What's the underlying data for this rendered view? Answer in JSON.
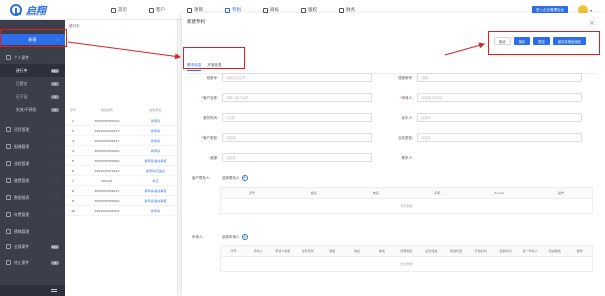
{
  "app": {
    "logo_name": "启翔",
    "logo_sub": "qixiang"
  },
  "topnav": [
    {
      "label": "首页",
      "icon": "home-icon",
      "active": false
    },
    {
      "label": "客户",
      "icon": "user-icon",
      "active": false
    },
    {
      "label": "项目",
      "icon": "project-icon",
      "active": false
    },
    {
      "label": "专利",
      "icon": "patent-icon",
      "active": true
    },
    {
      "label": "商标",
      "icon": "trademark-icon",
      "active": false
    },
    {
      "label": "版权",
      "icon": "copyright-icon",
      "active": false
    },
    {
      "label": "财务",
      "icon": "finance-icon",
      "active": false
    }
  ],
  "topbar": {
    "enter_button": "进入企业管理后台"
  },
  "sidebar": {
    "new_button": "新建",
    "items": [
      {
        "label": "个人案件",
        "count": "",
        "sub": false,
        "active": false
      },
      {
        "label": "进行中",
        "count": "99+",
        "sub": true,
        "active": true
      },
      {
        "label": "已提交",
        "count": "0",
        "sub": true,
        "active": false
      },
      {
        "label": "已下证",
        "count": "0",
        "sub": true,
        "active": false
      },
      {
        "label": "失效/不授权",
        "count": "0",
        "sub": true,
        "active": false
      },
      {
        "label": "项目管理",
        "count": "",
        "sub": false,
        "active": false
      },
      {
        "label": "配偶管理",
        "count": "",
        "sub": false,
        "active": false
      },
      {
        "label": "流程管理",
        "count": "",
        "sub": false,
        "active": false
      },
      {
        "label": "缴费管理",
        "count": "",
        "sub": false,
        "active": false
      },
      {
        "label": "数据报表",
        "count": "",
        "sub": false,
        "active": false
      },
      {
        "label": "年费管理",
        "count": "",
        "sub": false,
        "active": false
      },
      {
        "label": "撰稿管理",
        "count": "",
        "sub": false,
        "active": false
      },
      {
        "label": "全部案件",
        "count": "99+",
        "sub": false,
        "active": false
      },
      {
        "label": "终止案件",
        "count": "0",
        "sub": false,
        "active": false
      }
    ]
  },
  "list": {
    "tab": "进行中",
    "headers": {
      "idx": "序号",
      "num": "档案编号",
      "stat": "案件状态"
    },
    "rows": [
      {
        "idx": "1",
        "num": "P202005000010",
        "stat": "新申请"
      },
      {
        "idx": "2",
        "num": "P202005000013",
        "stat": "新申请"
      },
      {
        "idx": "3",
        "num": "P202005000017",
        "stat": "新申请"
      },
      {
        "idx": "4",
        "num": "P202005000009",
        "stat": "新申请"
      },
      {
        "idx": "5",
        "num": "P202005000006",
        "stat": "新申请/提交审核"
      },
      {
        "idx": "6",
        "num": "P202005070019",
        "stat": "新申请/已提交"
      },
      {
        "idx": "7",
        "num": "200321",
        "stat": "补正"
      },
      {
        "idx": "8",
        "num": "P202005000011",
        "stat": "新申请/提交审核"
      },
      {
        "idx": "9",
        "num": "P202005000009",
        "stat": "新申请/提交审核"
      },
      {
        "idx": "10",
        "num": "P202005000003",
        "stat": "新申请"
      }
    ]
  },
  "modal": {
    "title": "新建专利",
    "buttons": {
      "cancel": "取消",
      "save": "保存",
      "submit": "提交",
      "save_add": "保存并继续添加"
    },
    "tabs": [
      "基本信息",
      "开卷信息"
    ],
    "fields": {
      "case_no": {
        "label": "档案号:",
        "placeholder": "系统自动生成"
      },
      "proposal_no": {
        "label": "提案案号:",
        "placeholder": "请输入"
      },
      "client_name": {
        "label": "客户名称:",
        "placeholder": "请输入客户名称"
      },
      "applicant": {
        "label": "申请人:",
        "placeholder": "请选择(可多选)"
      },
      "entrust_date": {
        "label": "委托时间:",
        "placeholder": "日期"
      },
      "agent": {
        "label": "经手人:",
        "placeholder": "请选择"
      },
      "case_type": {
        "label": "客户类型:",
        "placeholder": "请选择"
      },
      "business_type": {
        "label": "业务类型:",
        "placeholder": "请选择"
      },
      "source": {
        "label": "案源:",
        "placeholder": "请选择"
      },
      "liaison": {
        "label": "联系人:",
        "placeholder": ""
      }
    },
    "contacts": {
      "label": "客户联系人:",
      "add_label": "选择联系人",
      "headers": [
        "序号",
        "姓名",
        "电话",
        "手机",
        "E-mail",
        "操作"
      ],
      "empty": "暂无数据"
    },
    "applicants": {
      "label": "申请人:",
      "add_label": "选择申请人",
      "headers": [
        "序号",
        "申请人",
        "申请人类型",
        "证件号码",
        "国籍",
        "地址",
        "邮编",
        "所属地区",
        "是否费减",
        "费减年度",
        "开始时间",
        "结束时间",
        "第一申请人",
        "费减审批",
        "操作"
      ],
      "empty": "暂无数据"
    }
  }
}
